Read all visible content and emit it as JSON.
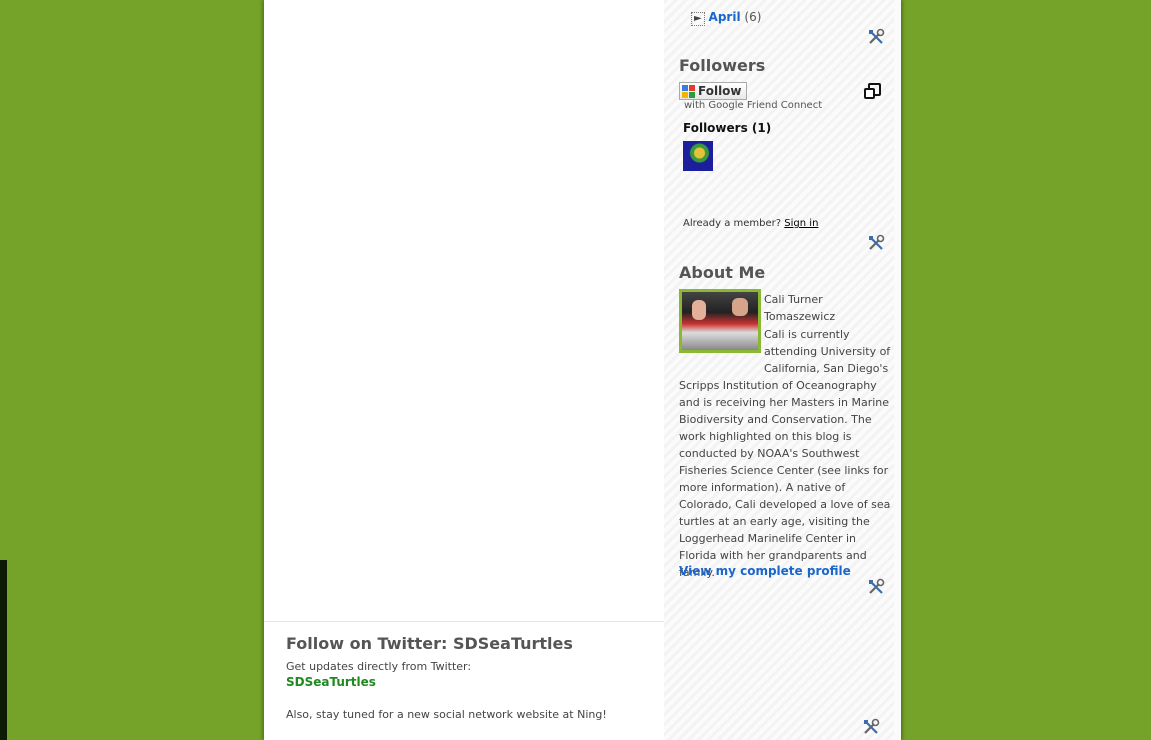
{
  "archive": {
    "toggle": "►",
    "month": "April",
    "count": "(6)"
  },
  "followers": {
    "title": "Followers",
    "follow_button": "Follow",
    "gfc_caption": "with Google Friend Connect",
    "count_label": "Followers (1)",
    "already_member": "Already a member?",
    "sign_in": "Sign in"
  },
  "about": {
    "title": "About Me",
    "name": "Cali Turner Tomaszewicz",
    "bio": "Cali is currently attending University of California, San Diego's Scripps Institution of Oceanography and is receiving her Masters in Marine Biodiversity and Conservation. The work highlighted on this blog is conducted by NOAA's Southwest Fisheries Science Center (see links for more information). A native of Colorado, Cali developed a love of sea turtles at an early age, visiting the Loggerhead Marinelife Center in Florida with her grandparents and family.",
    "profile_link": "View my complete profile"
  },
  "twitter": {
    "title": "Follow on Twitter: SDSeaTurtles",
    "subtitle": "Get updates directly from Twitter:",
    "handle": "SDSeaTurtles",
    "ning_note": "Also, stay tuned for a new social network website at Ning!"
  },
  "colors": {
    "background": "#75a228",
    "link_blue": "#1a66cc",
    "twitter_green": "#1e8a1e",
    "photo_border": "#8ab832"
  },
  "icons": [
    "quick-edit-tools-icon",
    "google-friend-connect-icon",
    "popout-icon",
    "expand-triangle-icon"
  ]
}
